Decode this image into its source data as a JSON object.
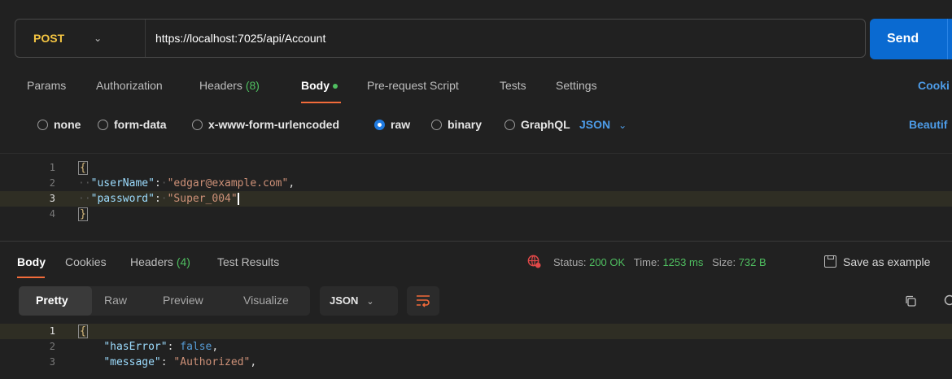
{
  "request": {
    "method": "POST",
    "url": "https://localhost:7025/api/Account",
    "send_label": "Send"
  },
  "request_tabs": {
    "params": "Params",
    "authorization": "Authorization",
    "headers": "Headers",
    "headers_count": "(8)",
    "body": "Body",
    "pre_request": "Pre-request Script",
    "tests": "Tests",
    "settings": "Settings",
    "cookies": "Cooki"
  },
  "body_types": {
    "none": "none",
    "form_data": "form-data",
    "urlencoded": "x-www-form-urlencoded",
    "raw": "raw",
    "binary": "binary",
    "graphql": "GraphQL",
    "format": "JSON",
    "beautify": "Beautif"
  },
  "request_body": {
    "line_numbers": [
      "1",
      "2",
      "3",
      "4"
    ],
    "open_brace": "{",
    "close_brace": "}",
    "user_key": "\"userName\"",
    "user_value": "\"edgar@example.com\"",
    "pass_key": "\"password\"",
    "pass_value": "\"Super_004\""
  },
  "response_tabs": {
    "body": "Body",
    "cookies": "Cookies",
    "headers": "Headers",
    "headers_count": "(4)",
    "test_results": "Test Results"
  },
  "response_status": {
    "status_label": "Status:",
    "status_value": "200 OK",
    "time_label": "Time:",
    "time_value": "1253 ms",
    "size_label": "Size:",
    "size_value": "732 B",
    "save_example": "Save as example"
  },
  "response_toolbar": {
    "pretty": "Pretty",
    "raw": "Raw",
    "preview": "Preview",
    "visualize": "Visualize",
    "format": "JSON"
  },
  "response_body": {
    "line_numbers": [
      "1",
      "2",
      "3"
    ],
    "open_brace": "{",
    "has_error_key": "\"hasError\"",
    "has_error_value": "false",
    "message_key": "\"message\"",
    "message_value": "\"Authorized\""
  },
  "colors": {
    "accent_orange": "#f26b3a",
    "send_blue": "#0a6ad1",
    "status_green": "#4fbf60",
    "link_blue": "#4d9ce8",
    "method_yellow": "#f4c542"
  }
}
